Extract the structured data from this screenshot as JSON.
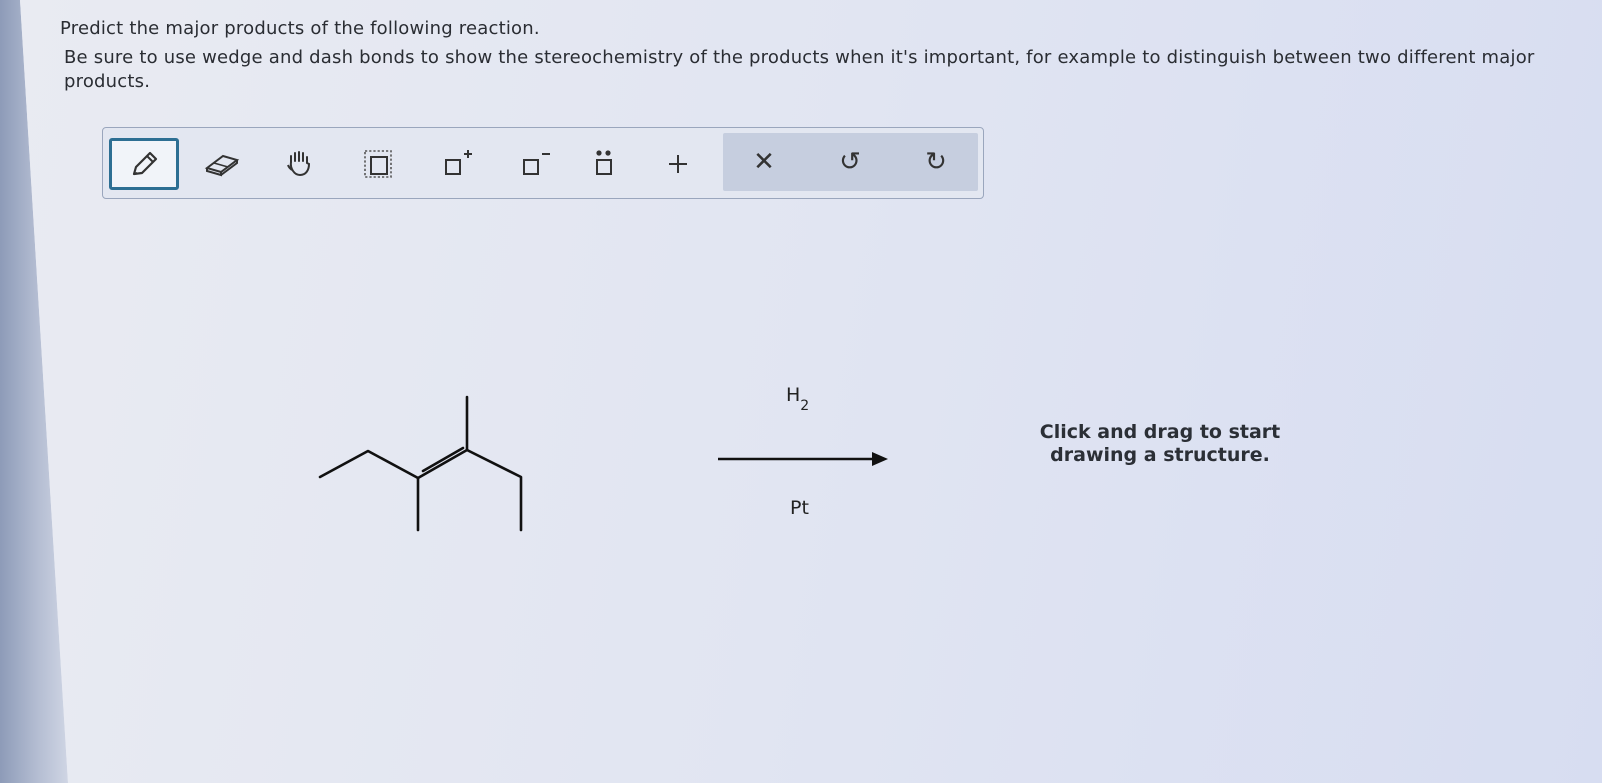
{
  "question": {
    "prompt": "Predict the major products of the following reaction.",
    "instructions": "Be sure to use wedge and dash bonds to show the stereochemistry of the products when it's important, for example to distinguish between two different major products."
  },
  "toolbar": {
    "tools": [
      {
        "name": "pencil-icon",
        "label": "Draw"
      },
      {
        "name": "eraser-icon",
        "label": "Erase"
      },
      {
        "name": "hand-icon",
        "label": "Move"
      },
      {
        "name": "select-box-icon",
        "label": "Select"
      },
      {
        "name": "positive-charge-icon",
        "label": "+"
      },
      {
        "name": "negative-charge-icon",
        "label": "−"
      },
      {
        "name": "lone-pair-icon",
        "label": "Lone pair"
      },
      {
        "name": "plus-icon",
        "label": "+"
      }
    ],
    "actions": [
      {
        "name": "clear-icon",
        "symbol": "✕"
      },
      {
        "name": "undo-icon",
        "symbol": "↺"
      },
      {
        "name": "redo-icon",
        "symbol": "↻"
      }
    ]
  },
  "reaction": {
    "reagent_above_main": "H",
    "reagent_above_sub": "2",
    "reagent_below": "Pt"
  },
  "canvas": {
    "hint_line1": "Click and drag to start",
    "hint_line2": "drawing a structure."
  },
  "colors": {
    "accent": "#2d6f93",
    "toolbar_group_bg": "#c6cedf"
  }
}
